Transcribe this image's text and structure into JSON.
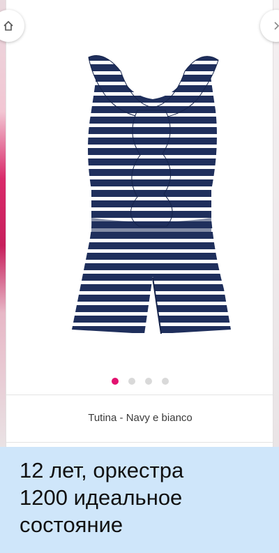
{
  "product": {
    "image_alt": "Striped navy and white ruffle romper",
    "name": "Tutina - Navy e bianco",
    "carousel": {
      "count": 4,
      "active_index": 0
    }
  },
  "message": {
    "lines": [
      "12 лет, оркестра",
      "1200 идеальное",
      "состояние"
    ]
  },
  "colors": {
    "navy": "#1f2f5c",
    "stripe": "#ffffff",
    "active_dot": "#e2126f",
    "message_bg": "#cfe6fa"
  },
  "icons": {
    "left_nav": "home-icon",
    "right_nav": "next-icon"
  }
}
